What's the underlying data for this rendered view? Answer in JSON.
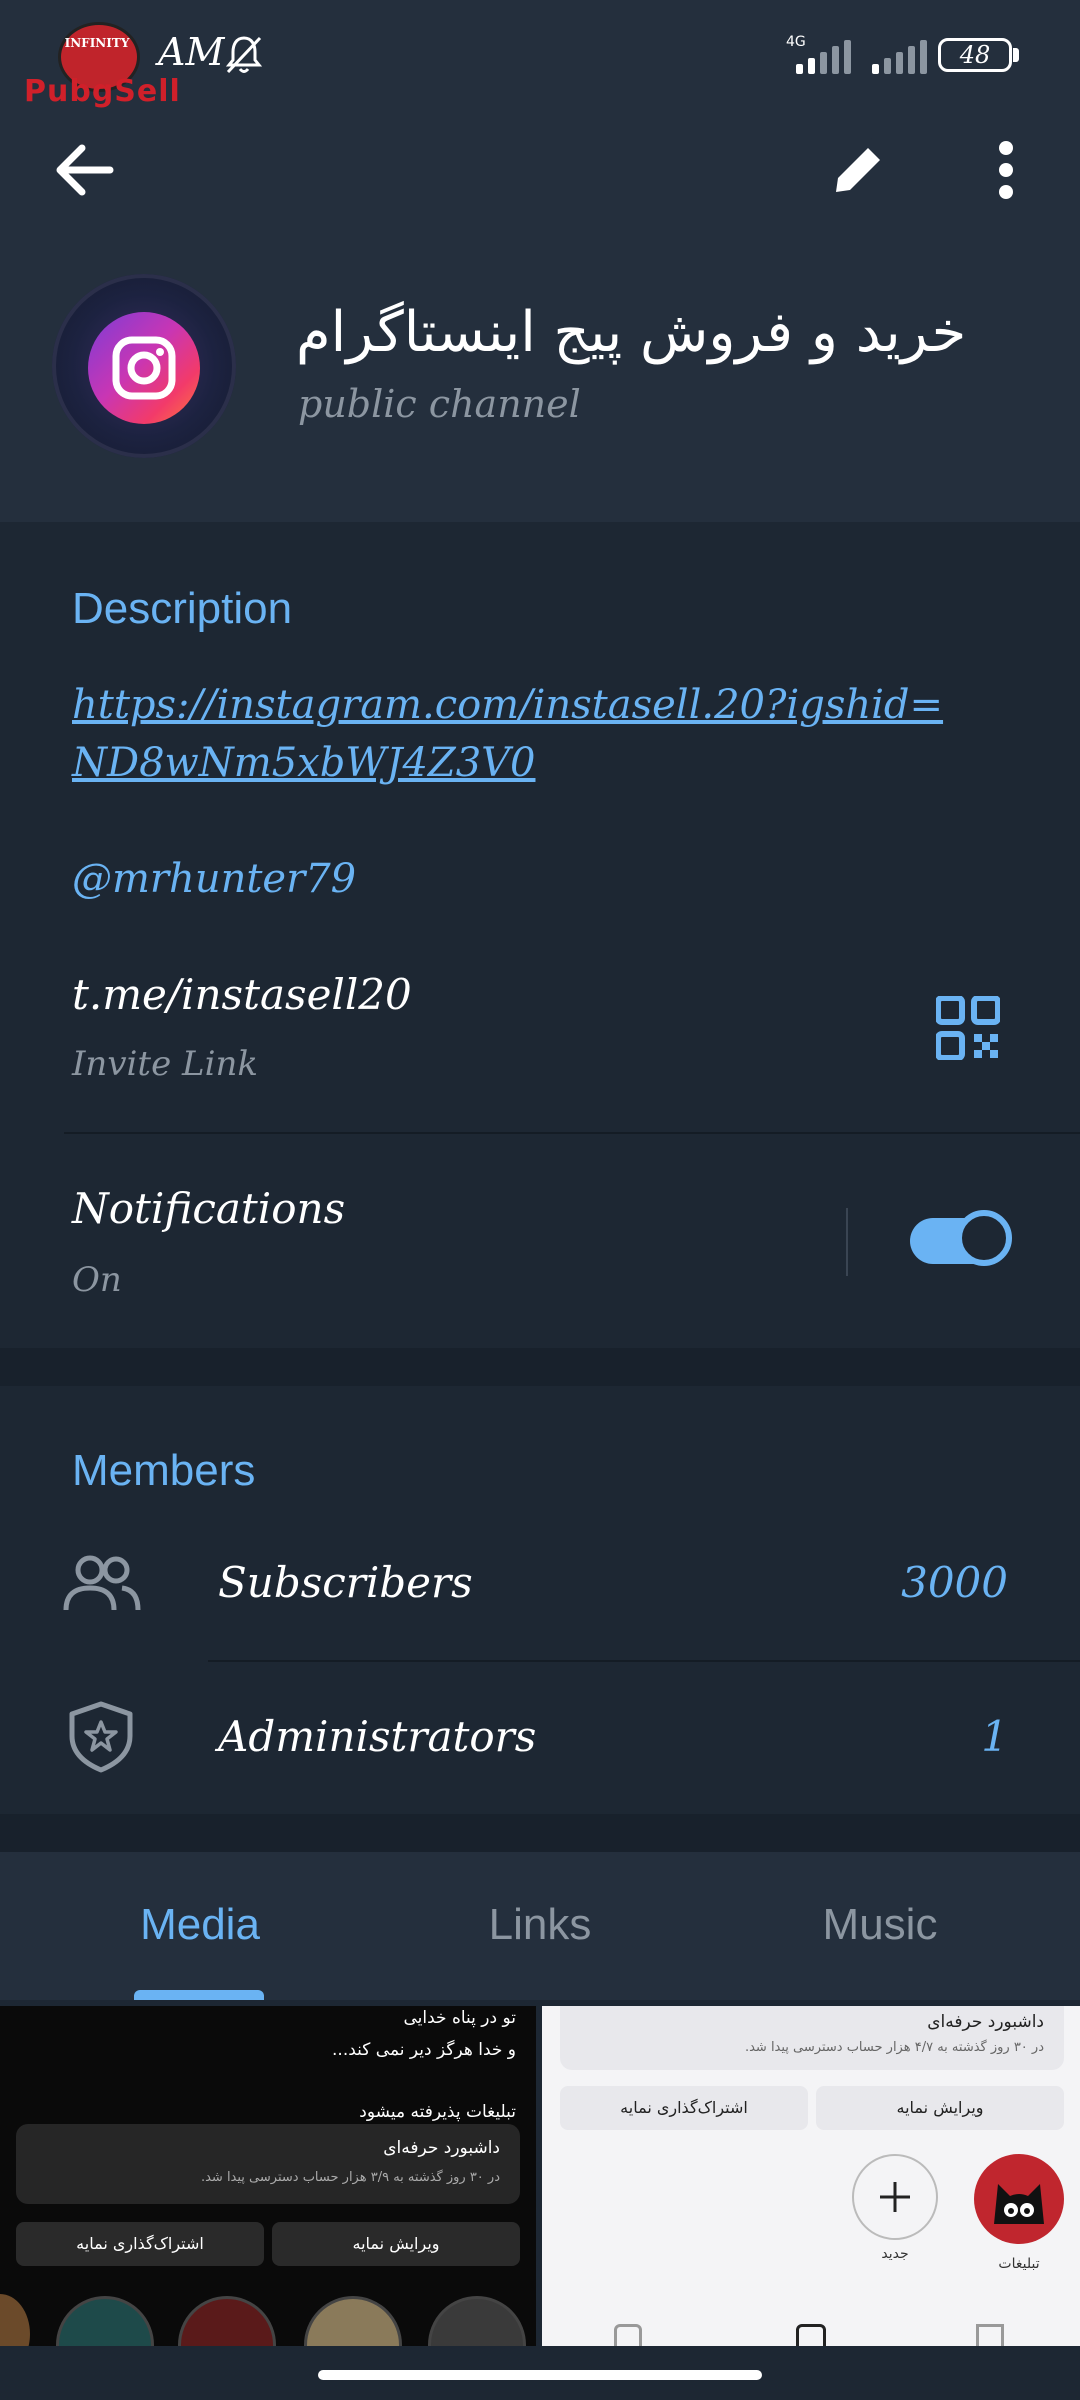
{
  "status_bar": {
    "time": "AM",
    "network": "4G",
    "battery": "48",
    "logo_text": "PubgSell",
    "logo_top": "INFINITY"
  },
  "toolbar": {
    "back_icon": "arrow-left-icon",
    "edit_icon": "pencil-icon",
    "more_icon": "more-vertical-icon"
  },
  "channel": {
    "title": "خرید و فروش پیج اینستاگرام",
    "type": "public  channel"
  },
  "info": {
    "description_title": "Description",
    "link_line1": "https://instagram.com/instasell.20?igshid=",
    "link_line2": "ND8wNm5xbWJ4Z3V0",
    "mention": "@mrhunter79",
    "invite_link": "t.me/instasell20",
    "invite_label": "Invite  Link",
    "notifications_label": "Notifications",
    "notifications_state": "On",
    "notifications_enabled": true
  },
  "members": {
    "title": "Members",
    "subscribers_label": "Subscribers",
    "subscribers_count": "3000",
    "admins_label": "Administrators",
    "admins_count": "1"
  },
  "tabs": {
    "media": "Media",
    "links": "Links",
    "music": "Music",
    "active": "Media"
  },
  "media": {
    "thumb1": {
      "line1": "تو در پناه خدایی",
      "line2": "و خدا هرگز دیر نمی کند...",
      "line3": "تبلیغات پذیرفته میشود",
      "card_title": "داشبورد حرفه‌ای",
      "card_sub": "در ۳۰ روز گذشته به ۳/۹ هزار حساب دسترسی پیدا شد.",
      "btn_share": "اشتراک‌گذاری نمایه",
      "btn_edit": "ویرایش نمایه"
    },
    "thumb2": {
      "card_title": "داشبورد حرفه‌ای",
      "card_sub": "در ۳۰ روز گذشته به ۴/۷ هزار حساب دسترسی پیدا شد.",
      "btn_share": "اشتراک‌گذاری نمایه",
      "btn_edit": "ویرایش نمایه",
      "new_label": "جدید",
      "ads_label": "تبلیغات"
    }
  },
  "colors": {
    "accent": "#6ab3f3",
    "background": "#1d2733",
    "header": "#242f3d",
    "muted": "#8c96a1"
  }
}
